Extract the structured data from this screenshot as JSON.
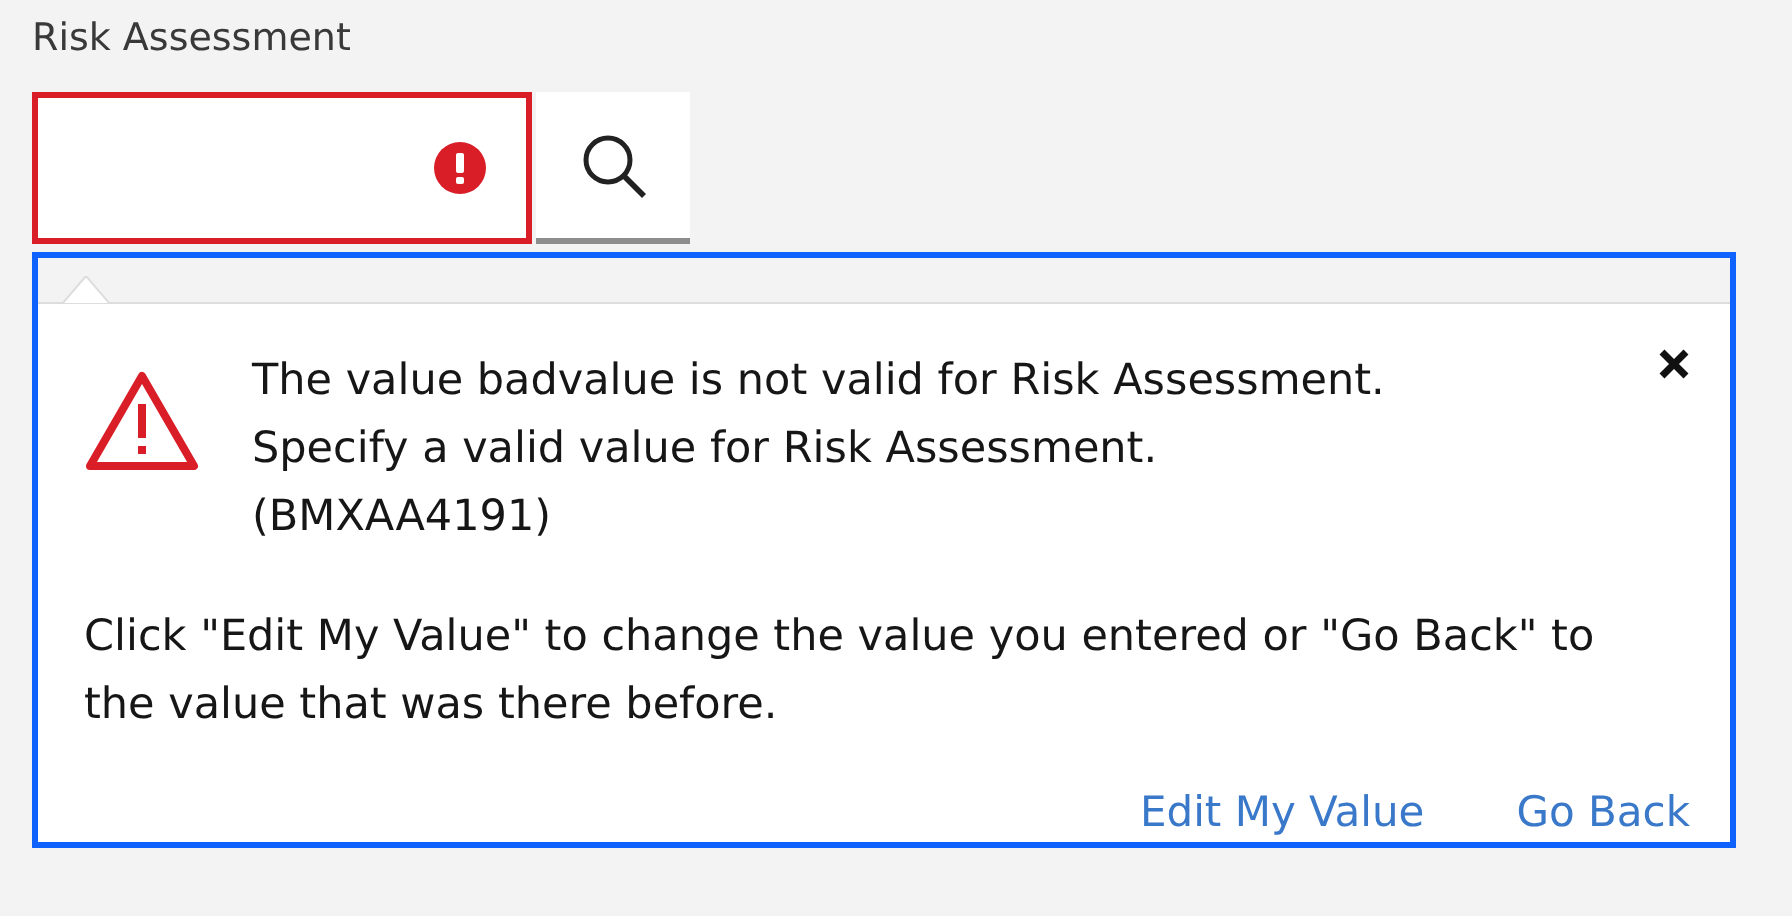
{
  "field": {
    "label": "Risk Assessment",
    "error": true
  },
  "popup": {
    "message": "The value badvalue is not valid for Risk Assessment. Specify a valid value for Risk Assessment. (BMXAA4191)",
    "instructions": "Click \"Edit My Value\" to change the value you entered or \"Go Back\" to the value that was there before.",
    "actions": [
      "Edit My Value",
      "Go Back"
    ]
  }
}
